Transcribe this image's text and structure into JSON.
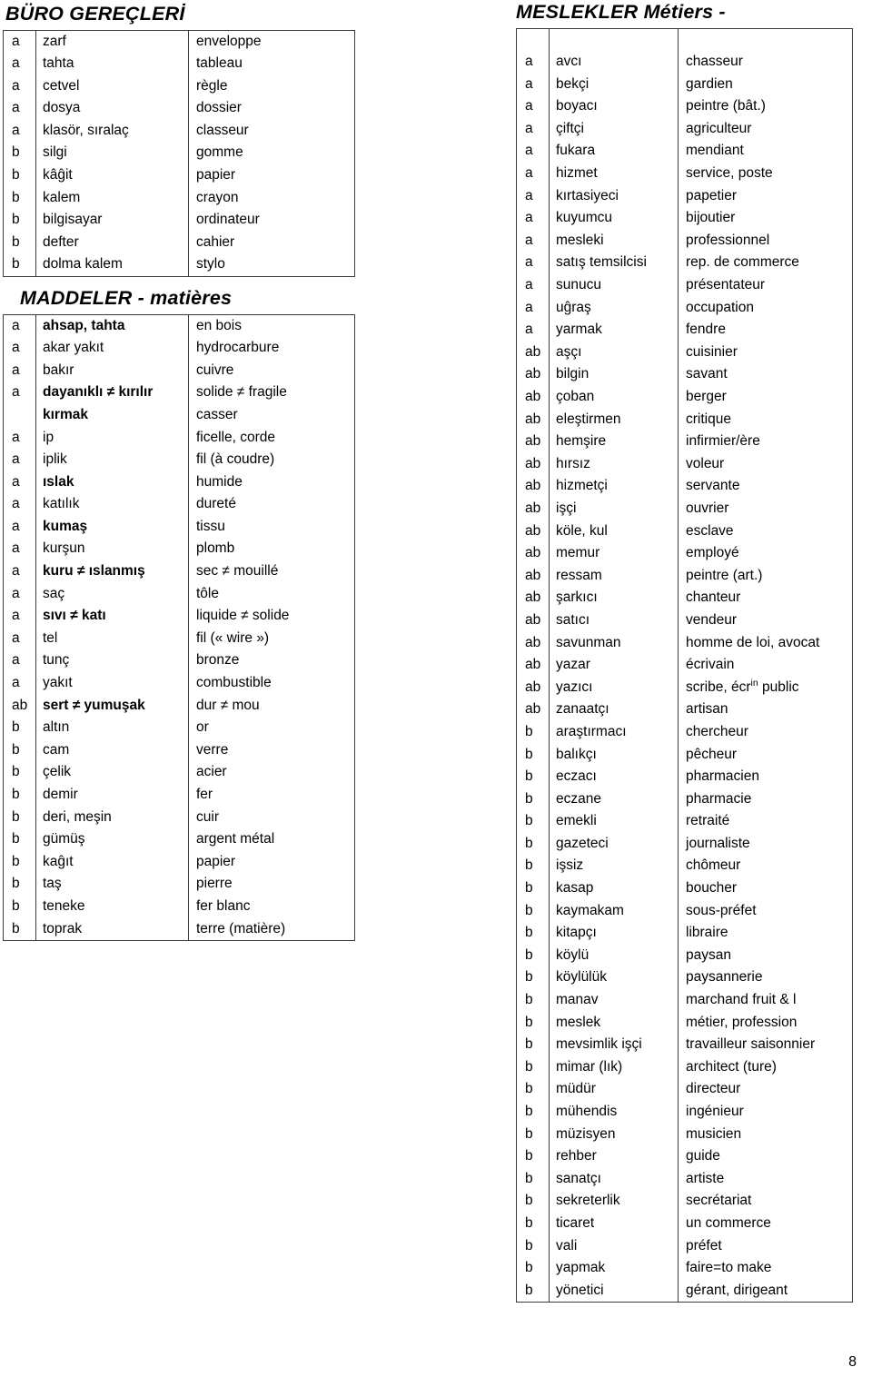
{
  "page": {
    "number": "8"
  },
  "sections": [
    {
      "id": "buro-gerecleri",
      "title": "BÜRO GEREÇLERİ",
      "rows": [
        {
          "mark": "a",
          "tr": "zarf",
          "fr": "enveloppe",
          "bold": false
        },
        {
          "mark": "a",
          "tr": "tahta",
          "fr": "tableau",
          "bold": false
        },
        {
          "mark": "a",
          "tr": "cetvel",
          "fr": "règle",
          "bold": false
        },
        {
          "mark": "a",
          "tr": "dosya",
          "fr": "dossier",
          "bold": false
        },
        {
          "mark": "a",
          "tr": "klasör, sıralaç",
          "fr": "classeur",
          "bold": false
        },
        {
          "mark": "b",
          "tr": "silgi",
          "fr": "gomme",
          "bold": false
        },
        {
          "mark": "b",
          "tr": "kâĝit",
          "fr": "papier",
          "bold": false
        },
        {
          "mark": "b",
          "tr": "kalem",
          "fr": "crayon",
          "bold": false
        },
        {
          "mark": "b",
          "tr": "bilgisayar",
          "fr": "ordinateur",
          "bold": false
        },
        {
          "mark": "b",
          "tr": "defter",
          "fr": "cahier",
          "bold": false
        },
        {
          "mark": "b",
          "tr": "dolma kalem",
          "fr": "stylo",
          "bold": false
        }
      ]
    },
    {
      "id": "maddeler",
      "title": "MADDELER - matières",
      "rows": [
        {
          "mark": "a",
          "tr": "ahsap, tahta",
          "fr": "en bois",
          "bold": true
        },
        {
          "mark": "a",
          "tr": "akar yakıt",
          "fr": "hydrocarbure",
          "bold": false
        },
        {
          "mark": "a",
          "tr": "bakır",
          "fr": "cuivre",
          "bold": false
        },
        {
          "mark": "a",
          "tr": "dayanıklı ≠ kırılır",
          "fr": "solide ≠ fragile",
          "bold": true
        },
        {
          "mark": "",
          "tr": "kırmak",
          "fr": "casser",
          "bold": true
        },
        {
          "mark": "a",
          "tr": "ip",
          "fr": "ficelle, corde",
          "bold": false
        },
        {
          "mark": "a",
          "tr": "iplik",
          "fr": "fil (à coudre)",
          "bold": false
        },
        {
          "mark": "a",
          "tr": "ıslak",
          "fr": "humide",
          "bold": true
        },
        {
          "mark": "a",
          "tr": "katılık",
          "fr": "dureté",
          "bold": false
        },
        {
          "mark": "a",
          "tr": "kumaş",
          "fr": "tissu",
          "bold": true
        },
        {
          "mark": "a",
          "tr": "kurşun",
          "fr": "plomb",
          "bold": false
        },
        {
          "mark": "a",
          "tr": "kuru ≠ ıslanmış",
          "fr": "sec ≠ mouillé",
          "bold": true
        },
        {
          "mark": "a",
          "tr": "saç",
          "fr": "tôle",
          "bold": false
        },
        {
          "mark": "a",
          "tr": "sıvı ≠ katı",
          "fr": "liquide ≠ solide",
          "bold": true
        },
        {
          "mark": "a",
          "tr": "tel",
          "fr": "fil (« wire »)",
          "bold": false
        },
        {
          "mark": "a",
          "tr": "tunç",
          "fr": "bronze",
          "bold": false
        },
        {
          "mark": "a",
          "tr": "yakıt",
          "fr": "combustible",
          "bold": false
        },
        {
          "mark": "ab",
          "tr": "sert ≠ yumuşak",
          "fr": "dur ≠ mou",
          "bold": true
        },
        {
          "mark": "b",
          "tr": "altın",
          "fr": "or",
          "bold": false
        },
        {
          "mark": "b",
          "tr": "cam",
          "fr": "verre",
          "bold": false
        },
        {
          "mark": "b",
          "tr": "çelik",
          "fr": "acier",
          "bold": false
        },
        {
          "mark": "b",
          "tr": "demir",
          "fr": "fer",
          "bold": false
        },
        {
          "mark": "b",
          "tr": "deri, meşin",
          "fr": "cuir",
          "bold": false
        },
        {
          "mark": "b",
          "tr": "gümüş",
          "fr": "argent métal",
          "bold": false
        },
        {
          "mark": "b",
          "tr": "kaĝıt",
          "fr": "papier",
          "bold": false
        },
        {
          "mark": "b",
          "tr": "taş",
          "fr": "pierre",
          "bold": false
        },
        {
          "mark": "b",
          "tr": "teneke",
          "fr": "fer blanc",
          "bold": false
        },
        {
          "mark": "b",
          "tr": "toprak",
          "fr": "terre (matière)",
          "bold": false
        }
      ]
    },
    {
      "id": "meslekler",
      "title": "MESLEKLER Métiers -",
      "rows": [
        {
          "mark": "",
          "tr": "",
          "fr": "",
          "bold": false
        },
        {
          "mark": "a",
          "tr": "avcı",
          "fr": "chasseur",
          "bold": false
        },
        {
          "mark": "a",
          "tr": "bekçi",
          "fr": "gardien",
          "bold": false
        },
        {
          "mark": "a",
          "tr": "boyacı",
          "fr": "peintre (bât.)",
          "bold": false
        },
        {
          "mark": "a",
          "tr": "çiftçi",
          "fr": "agriculteur",
          "bold": false
        },
        {
          "mark": "a",
          "tr": "fukara",
          "fr": "mendiant",
          "bold": false
        },
        {
          "mark": "a",
          "tr": "hizmet",
          "fr": "service, poste",
          "bold": false
        },
        {
          "mark": "a",
          "tr": "kırtasiyeci",
          "fr": "papetier",
          "bold": false
        },
        {
          "mark": "a",
          "tr": "kuyumcu",
          "fr": "bijoutier",
          "bold": false
        },
        {
          "mark": "a",
          "tr": "mesleki",
          "fr": "professionnel",
          "bold": false
        },
        {
          "mark": "a",
          "tr": "satış temsilcisi",
          "fr": "rep. de commerce",
          "bold": false
        },
        {
          "mark": "a",
          "tr": "sunucu",
          "fr": "présentateur",
          "bold": false
        },
        {
          "mark": "a",
          "tr": "uĝraş",
          "fr": "occupation",
          "bold": false
        },
        {
          "mark": "a",
          "tr": "yarmak",
          "fr": "fendre",
          "bold": false
        },
        {
          "mark": "ab",
          "tr": "aşçı",
          "fr": "cuisinier",
          "bold": false
        },
        {
          "mark": "ab",
          "tr": "bilgin",
          "fr": "savant",
          "bold": false
        },
        {
          "mark": "ab",
          "tr": "çoban",
          "fr": "berger",
          "bold": false
        },
        {
          "mark": "ab",
          "tr": "eleştirmen",
          "fr": "critique",
          "bold": false
        },
        {
          "mark": "ab",
          "tr": "hemşire",
          "fr": "infirmier/ère",
          "bold": false
        },
        {
          "mark": "ab",
          "tr": "hırsız",
          "fr": "voleur",
          "bold": false
        },
        {
          "mark": "ab",
          "tr": "hizmetçi",
          "fr": "servante",
          "bold": false
        },
        {
          "mark": "ab",
          "tr": "işçi",
          "fr": "ouvrier",
          "bold": false
        },
        {
          "mark": "ab",
          "tr": "köle, kul",
          "fr": "esclave",
          "bold": false
        },
        {
          "mark": "ab",
          "tr": "memur",
          "fr": "employé",
          "bold": false
        },
        {
          "mark": "ab",
          "tr": "ressam",
          "fr": "peintre (art.)",
          "bold": false
        },
        {
          "mark": "ab",
          "tr": "şarkıcı",
          "fr": "chanteur",
          "bold": false
        },
        {
          "mark": "ab",
          "tr": "satıcı",
          "fr": "vendeur",
          "bold": false
        },
        {
          "mark": "ab",
          "tr": "savunman",
          "fr": "homme de loi, avocat",
          "bold": false
        },
        {
          "mark": "ab",
          "tr": "yazar",
          "fr": "écrivain",
          "bold": false
        },
        {
          "mark": "ab",
          "tr": "yazıcı",
          "fr": "scribe, écr",
          "fr_sup": "in",
          "fr_tail": " public",
          "bold": false
        },
        {
          "mark": "ab",
          "tr": "zanaatçı",
          "fr": "artisan",
          "bold": false
        },
        {
          "mark": "b",
          "tr": "araştırmacı",
          "fr": "chercheur",
          "bold": false
        },
        {
          "mark": "b",
          "tr": "balıkçı",
          "fr": "pêcheur",
          "bold": false
        },
        {
          "mark": "b",
          "tr": "eczacı",
          "fr": "pharmacien",
          "bold": false
        },
        {
          "mark": "b",
          "tr": "eczane",
          "fr": "pharmacie",
          "bold": false
        },
        {
          "mark": "b",
          "tr": "emekli",
          "fr": "retraité",
          "bold": false
        },
        {
          "mark": "b",
          "tr": "gazeteci",
          "fr": "journaliste",
          "bold": false
        },
        {
          "mark": "b",
          "tr": "işsiz",
          "fr": "chômeur",
          "bold": false
        },
        {
          "mark": "b",
          "tr": "kasap",
          "fr": "boucher",
          "bold": false
        },
        {
          "mark": "b",
          "tr": "kaymakam",
          "fr": "sous-préfet",
          "bold": false
        },
        {
          "mark": "b",
          "tr": "kitapçı",
          "fr": "libraire",
          "bold": false
        },
        {
          "mark": "b",
          "tr": "köylü",
          "fr": "paysan",
          "bold": false
        },
        {
          "mark": "b",
          "tr": "köylülük",
          "fr": "paysannerie",
          "bold": false
        },
        {
          "mark": "b",
          "tr": "manav",
          "fr": "marchand fruit & l",
          "bold": false
        },
        {
          "mark": "b",
          "tr": "meslek",
          "fr": "métier, profession",
          "bold": false
        },
        {
          "mark": "b",
          "tr": "mevsimlik işçi",
          "fr": "travailleur saisonnier",
          "bold": false
        },
        {
          "mark": "b",
          "tr": "mimar (lık)",
          "fr": "architect (ture)",
          "bold": false
        },
        {
          "mark": "b",
          "tr": "müdür",
          "fr": "directeur",
          "bold": false
        },
        {
          "mark": "b",
          "tr": "mühendis",
          "fr": "ingénieur",
          "bold": false
        },
        {
          "mark": "b",
          "tr": "müzisyen",
          "fr": "musicien",
          "bold": false
        },
        {
          "mark": "b",
          "tr": "rehber",
          "fr": "guide",
          "bold": false
        },
        {
          "mark": "b",
          "tr": "sanatçı",
          "fr": "artiste",
          "bold": false
        },
        {
          "mark": "b",
          "tr": "sekreterlik",
          "fr": "secrétariat",
          "bold": false
        },
        {
          "mark": "b",
          "tr": "ticaret",
          "fr": "un commerce",
          "bold": false
        },
        {
          "mark": "b",
          "tr": "vali",
          "fr": "préfet",
          "bold": false
        },
        {
          "mark": "b",
          "tr": "yapmak",
          "fr": "faire=to make",
          "bold": false
        },
        {
          "mark": "b",
          "tr": "yönetici",
          "fr": "gérant, dirigeant",
          "bold": false
        }
      ]
    }
  ]
}
